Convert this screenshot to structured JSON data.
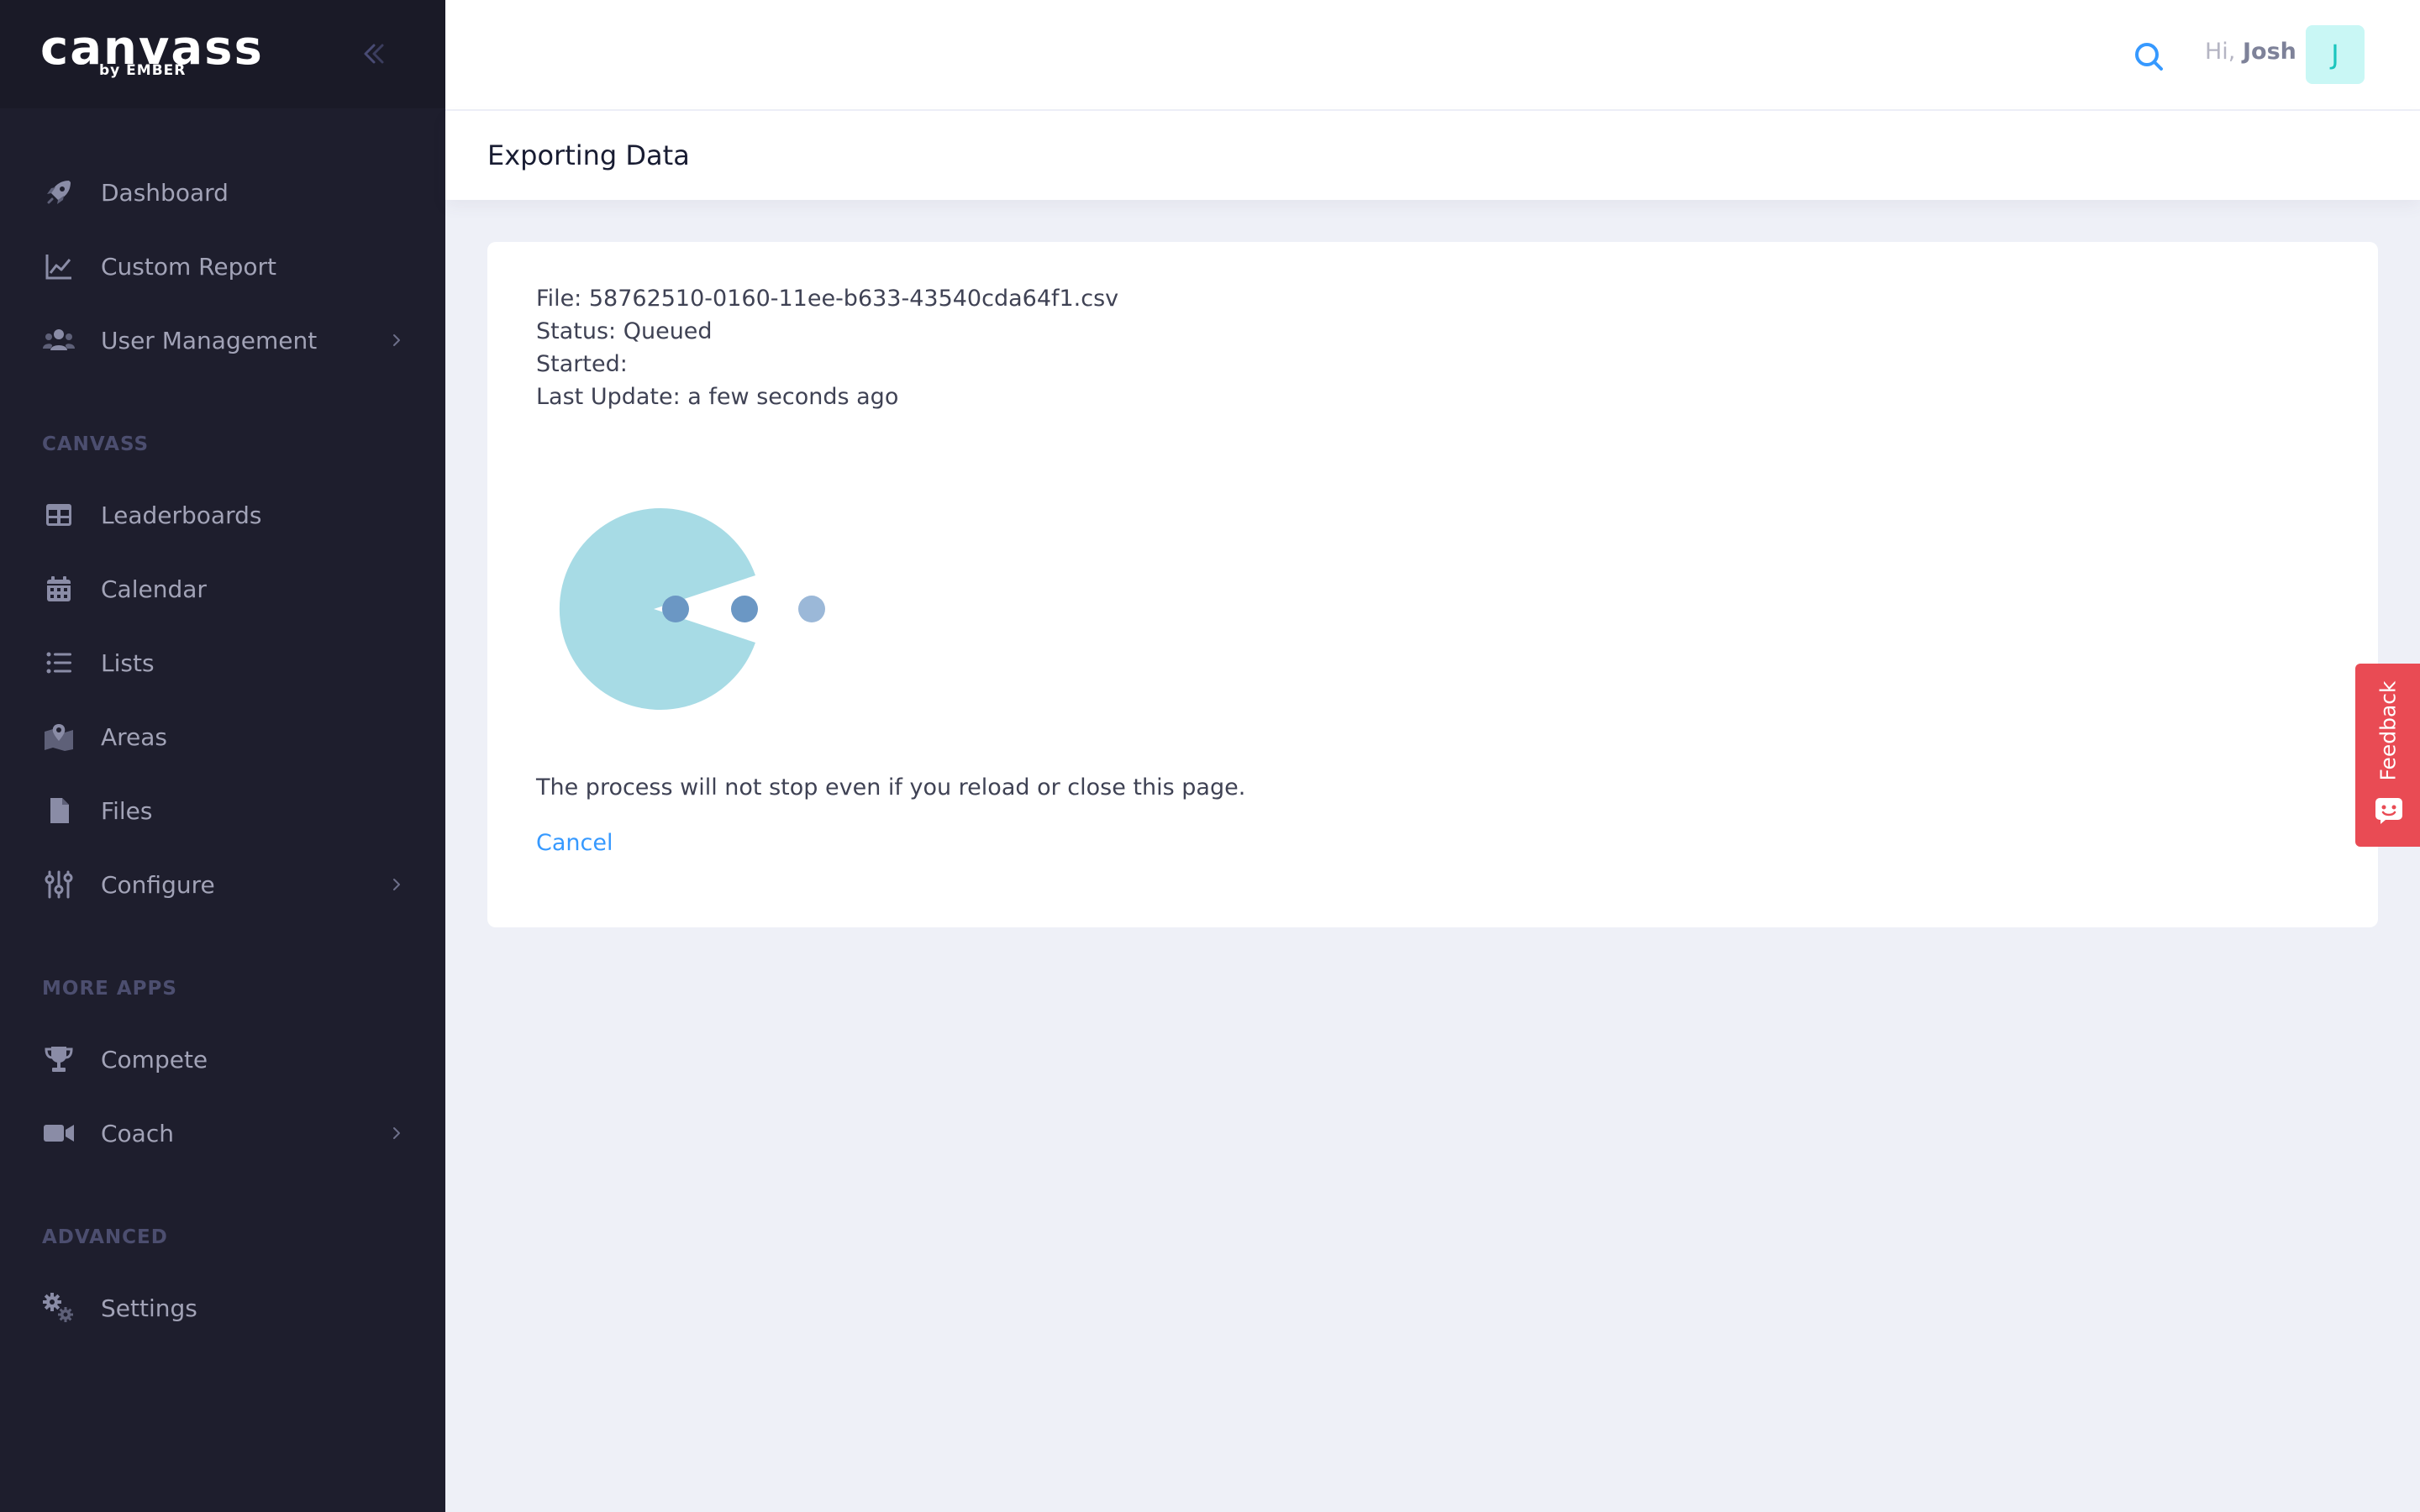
{
  "brand": {
    "logo_text": "canvass",
    "logo_sub": "by EMBER"
  },
  "sidebar": {
    "items": [
      {
        "label": "Dashboard",
        "icon": "rocket-icon"
      },
      {
        "label": "Custom Report",
        "icon": "line-chart-icon"
      },
      {
        "label": "User Management",
        "icon": "users-icon"
      }
    ],
    "sections": [
      {
        "title": "CANVASS",
        "items": [
          {
            "label": "Leaderboards",
            "icon": "table-icon"
          },
          {
            "label": "Calendar",
            "icon": "calendar-icon"
          },
          {
            "label": "Lists",
            "icon": "list-icon"
          },
          {
            "label": "Areas",
            "icon": "map-pin-icon"
          },
          {
            "label": "Files",
            "icon": "file-icon"
          },
          {
            "label": "Configure",
            "icon": "sliders-icon"
          }
        ]
      },
      {
        "title": "MORE APPS",
        "items": [
          {
            "label": "Compete",
            "icon": "trophy-icon"
          },
          {
            "label": "Coach",
            "icon": "video-icon"
          }
        ]
      },
      {
        "title": "ADVANCED",
        "items": [
          {
            "label": "Settings",
            "icon": "gears-icon"
          }
        ]
      }
    ]
  },
  "header": {
    "greeting": "Hi,",
    "user_name": "Josh",
    "avatar_initial": "J"
  },
  "page": {
    "title": "Exporting Data"
  },
  "export": {
    "file_line": "File: 58762510-0160-11ee-b633-43540cda64f1.csv",
    "status_line": "Status: Queued",
    "started_line": "Started:",
    "last_update_line": "Last Update: a few seconds ago",
    "note": "The process will not stop even if you reload or close this page.",
    "cancel_label": "Cancel"
  },
  "feedback": {
    "label": "Feedback"
  },
  "colors": {
    "sidebar_bg": "#1e1e2d",
    "accent": "#3699ff",
    "feedback": "#e94b54",
    "avatar_bg": "#c9f7f5",
    "avatar_text": "#1bc5bd",
    "loader_body": "#a7dbe5",
    "loader_dot": "#6b97c4"
  }
}
